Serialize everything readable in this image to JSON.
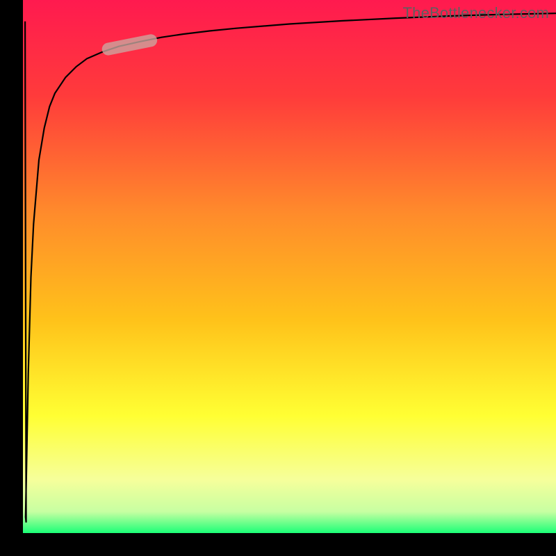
{
  "attribution": "TheBottlenecker.com",
  "chart_data": {
    "type": "line",
    "title": "",
    "xlabel": "",
    "ylabel": "",
    "xlim": [
      0,
      100
    ],
    "ylim": [
      0,
      100
    ],
    "axes_visible": false,
    "gradient_background": {
      "stops": [
        {
          "offset": 0.0,
          "color": "#ff1a4f"
        },
        {
          "offset": 0.18,
          "color": "#ff3b3b"
        },
        {
          "offset": 0.4,
          "color": "#ff8b2b"
        },
        {
          "offset": 0.6,
          "color": "#ffc21a"
        },
        {
          "offset": 0.78,
          "color": "#ffff33"
        },
        {
          "offset": 0.9,
          "color": "#f6ff9b"
        },
        {
          "offset": 0.96,
          "color": "#c7ffa2"
        },
        {
          "offset": 1.0,
          "color": "#1bff77"
        }
      ]
    },
    "frame": {
      "color": "#000000",
      "left_thickness": 33,
      "bottom_thickness": 33,
      "top_thickness": 0,
      "right_thickness": 0
    },
    "curve": {
      "color": "#000000",
      "stroke_width": 2.2,
      "note": "y values estimated from pixel positions; curve rises steeply from ~0 then asymptotes near ~97",
      "x": [
        0.5,
        1,
        1.5,
        2,
        3,
        4,
        5,
        6,
        8,
        10,
        12,
        15,
        18,
        22,
        26,
        30,
        35,
        40,
        50,
        60,
        70,
        80,
        90,
        100
      ],
      "y": [
        3,
        30,
        48,
        58,
        70,
        76,
        80,
        82.5,
        85.5,
        87.5,
        89,
        90.3,
        91.3,
        92.2,
        93,
        93.6,
        94.2,
        94.7,
        95.5,
        96.1,
        96.6,
        97,
        97.3,
        97.5
      ]
    },
    "highlight_pill": {
      "description": "rounded segment overlay on the curve",
      "color": "#caa8a0",
      "opacity": 0.78,
      "radius_px": 9,
      "x_range": [
        16,
        24
      ],
      "y_range": [
        90.8,
        92.4
      ]
    }
  }
}
